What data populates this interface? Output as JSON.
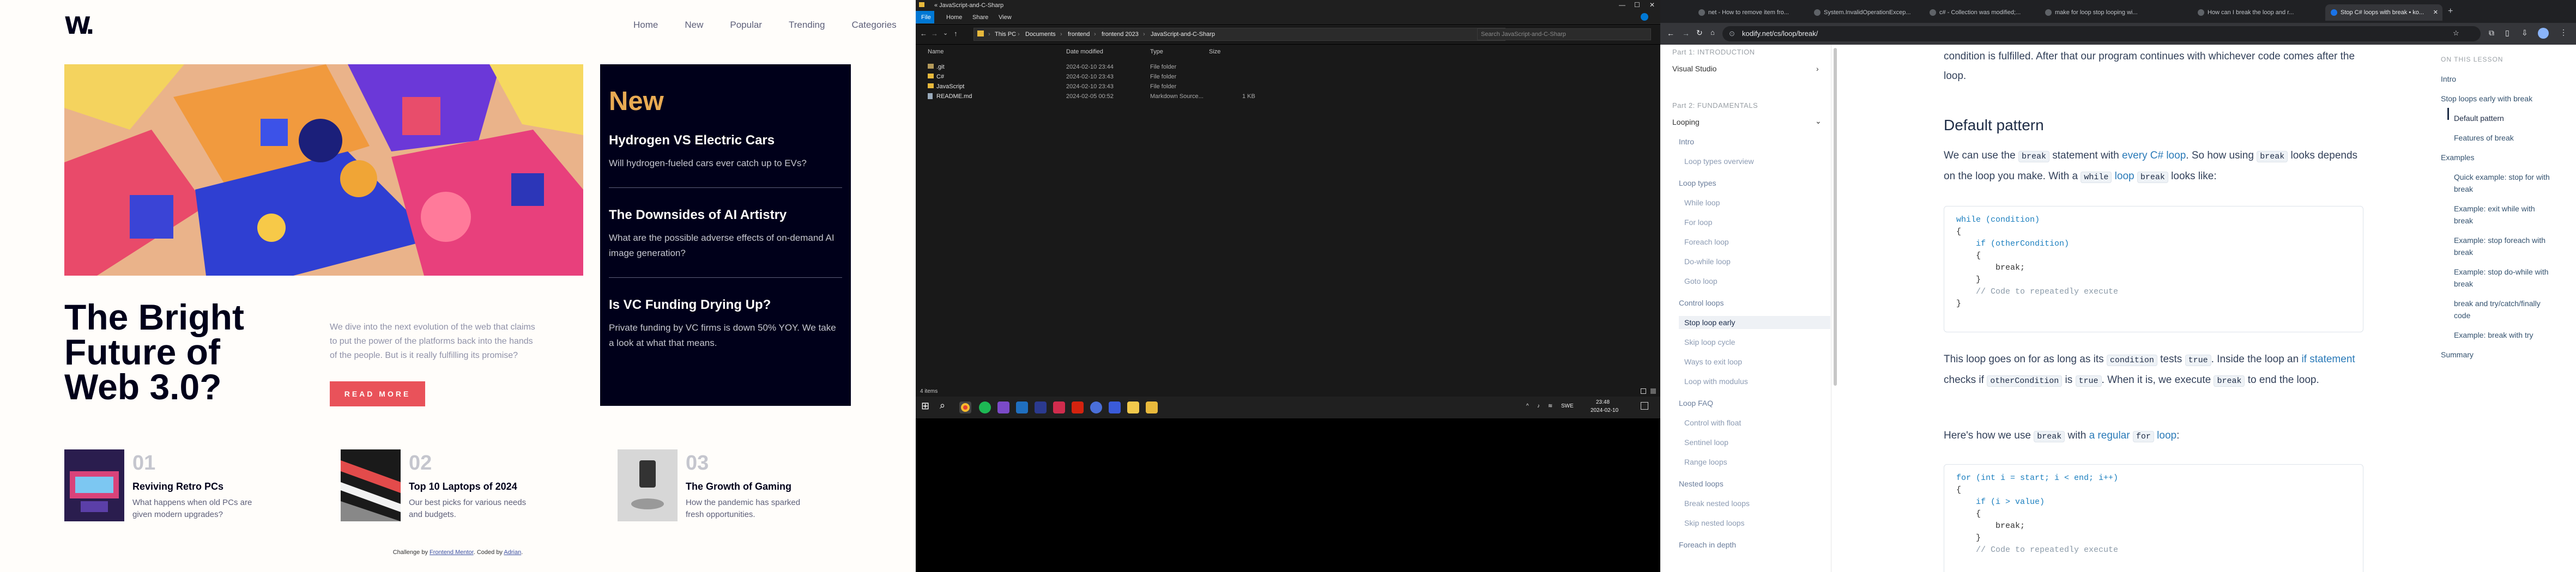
{
  "home": {
    "logo": "W.",
    "nav": [
      "Home",
      "New",
      "Popular",
      "Trending",
      "Categories"
    ],
    "headline": "The Bright Future of Web 3.0?",
    "description": "We dive into the next evolution of the web that claims to put the power of the platforms back into the hands of the people. But is it really fulfilling its promise?",
    "read_more": "READ MORE",
    "new_heading": "New",
    "new_items": [
      {
        "title": "Hydrogen VS Electric Cars",
        "text": "Will hydrogen-fueled cars ever catch up to EVs?"
      },
      {
        "title": "The Downsides of AI Artistry",
        "text": "What are the possible adverse effects of on-demand AI image generation?"
      },
      {
        "title": "Is VC Funding Drying Up?",
        "text": "Private funding by VC firms is down 50% YOY. We take a look at what that means."
      }
    ],
    "cards": [
      {
        "num": "01",
        "title": "Reviving Retro PCs",
        "text": "What happens when old PCs are given modern upgrades?"
      },
      {
        "num": "02",
        "title": "Top 10 Laptops of 2024",
        "text": "Our best picks for various needs and budgets."
      },
      {
        "num": "03",
        "title": "The Growth of Gaming",
        "text": "How the pandemic has sparked fresh opportunities."
      }
    ],
    "footer_pre": "Challenge by ",
    "footer_link1": "Frontend Mentor",
    "footer_mid": ". Coded by ",
    "footer_link2": "Adrian",
    "footer_end": "."
  },
  "explorer": {
    "title": "« JavaScript-and-C-Sharp",
    "ribbon": [
      "File",
      "Home",
      "Share",
      "View"
    ],
    "breadcrumb": [
      "This PC",
      "Documents",
      "frontend",
      "frontend 2023",
      "JavaScript-and-C-Sharp"
    ],
    "search_placeholder": "Search JavaScript-and-C-Sharp",
    "columns": [
      "Name",
      "Date modified",
      "Type",
      "Size"
    ],
    "files": [
      {
        "name": ".git",
        "date": "2024-02-10 23:44",
        "type": "File folder",
        "size": ""
      },
      {
        "name": "C#",
        "date": "2024-02-10 23:43",
        "type": "File folder",
        "size": ""
      },
      {
        "name": "JavaScript",
        "date": "2024-02-10 23:43",
        "type": "File folder",
        "size": ""
      },
      {
        "name": "README.md",
        "date": "2024-02-05 00:52",
        "type": "Markdown Source...",
        "size": "1 KB"
      }
    ],
    "status": "4 items",
    "tray_lang": "SWE",
    "tray_time": "23:48",
    "tray_date": "2024-02-10",
    "colors": {
      "folder": "#e8b93c",
      "accent": "#0078d4"
    }
  },
  "browser": {
    "tabs": [
      "net - How to remove item fro...",
      "System.InvalidOperationExcep...",
      "c# - Collection was modified;...",
      "make for loop stop looping wi...",
      "How can I break the loop and r...",
      "Stop C# loops with break • ko..."
    ],
    "url": "kodify.net/cs/loop/break/",
    "sidebar": {
      "part1": "Part 1: INTRODUCTION",
      "visual_studio": "Visual Studio",
      "part2": "Part 2: FUNDAMENTALS",
      "looping": "Looping",
      "items": [
        {
          "label": "Intro",
          "kind": "grp"
        },
        {
          "label": "Loop types overview",
          "kind": "sub"
        },
        {
          "label": "Loop types",
          "kind": "grp"
        },
        {
          "label": "While loop",
          "kind": "sub"
        },
        {
          "label": "For loop",
          "kind": "sub"
        },
        {
          "label": "Foreach loop",
          "kind": "sub"
        },
        {
          "label": "Do-while loop",
          "kind": "sub"
        },
        {
          "label": "Goto loop",
          "kind": "sub"
        },
        {
          "label": "Control loops",
          "kind": "grp"
        },
        {
          "label": "Stop loop early",
          "kind": "cur"
        },
        {
          "label": "Skip loop cycle",
          "kind": "sub"
        },
        {
          "label": "Ways to exit loop",
          "kind": "sub"
        },
        {
          "label": "Loop with modulus",
          "kind": "sub"
        },
        {
          "label": "Loop FAQ",
          "kind": "grp"
        },
        {
          "label": "Control with float",
          "kind": "sub"
        },
        {
          "label": "Sentinel loop",
          "kind": "sub"
        },
        {
          "label": "Range loops",
          "kind": "sub"
        },
        {
          "label": "Nested loops",
          "kind": "grp"
        },
        {
          "label": "Break nested loops",
          "kind": "sub"
        },
        {
          "label": "Skip nested loops",
          "kind": "sub"
        },
        {
          "label": "Foreach in depth",
          "kind": "grp"
        }
      ]
    },
    "article": {
      "intro_tail": "condition is fulfilled. After that our program continues with whichever code comes after the loop.",
      "h_default": "Default pattern",
      "p1_a": "We can use the ",
      "p1_code1": "break",
      "p1_b": " statement with ",
      "p1_link": "every C# loop",
      "p1_c": ". So how using ",
      "p1_code2": "break",
      "p1_d": " looks depends on the loop you make. With a ",
      "p1_code3": "while",
      "p1_link2": "loop",
      "p1_code4": "break",
      "p1_e": " looks like:",
      "code1": [
        "while (condition)",
        "{",
        "    if (otherCondition)",
        "    {",
        "        break;",
        "    }",
        "",
        "    // Code to repeatedly execute",
        "}"
      ],
      "p2_a": "This loop goes on for as long as its ",
      "p2_code1": "condition",
      "p2_b": " tests ",
      "p2_code2": "true",
      "p2_c": ". Inside the loop an ",
      "p2_link": "if statement",
      "p2_d": " checks if ",
      "p2_code3": "otherCondition",
      "p2_e": " is ",
      "p2_code4": "true",
      "p2_f": ". When it is, we execute ",
      "p2_code5": "break",
      "p2_g": " to end the loop.",
      "p3_a": "Here's how we use ",
      "p3_code1": "break",
      "p3_b": " with ",
      "p3_link": "a regular",
      "p3_code2": "for",
      "p3_link2": "loop",
      "p3_c": ":",
      "code2": [
        "for (int i = start; i < end; i++)",
        "{",
        "    if (i > value)",
        "    {",
        "        break;",
        "    }",
        "",
        "    // Code to repeatedly execute"
      ]
    },
    "toc": {
      "title": "ON THIS LESSON",
      "items": [
        {
          "label": "Intro",
          "level": 0
        },
        {
          "label": "Stop loops early with break",
          "level": 0
        },
        {
          "label": "Default pattern",
          "level": 1
        },
        {
          "label": "Features of break",
          "level": 1
        },
        {
          "label": "Examples",
          "level": 0
        },
        {
          "label": "Quick example: stop for with break",
          "level": 1
        },
        {
          "label": "Example: exit while with break",
          "level": 1
        },
        {
          "label": "Example: stop foreach with break",
          "level": 1
        },
        {
          "label": "Example: stop do-while with break",
          "level": 1
        },
        {
          "label": "break and try/catch/finally code",
          "level": 1
        },
        {
          "label": "Example: break with try",
          "level": 1
        },
        {
          "label": "Summary",
          "level": 0
        }
      ]
    }
  }
}
